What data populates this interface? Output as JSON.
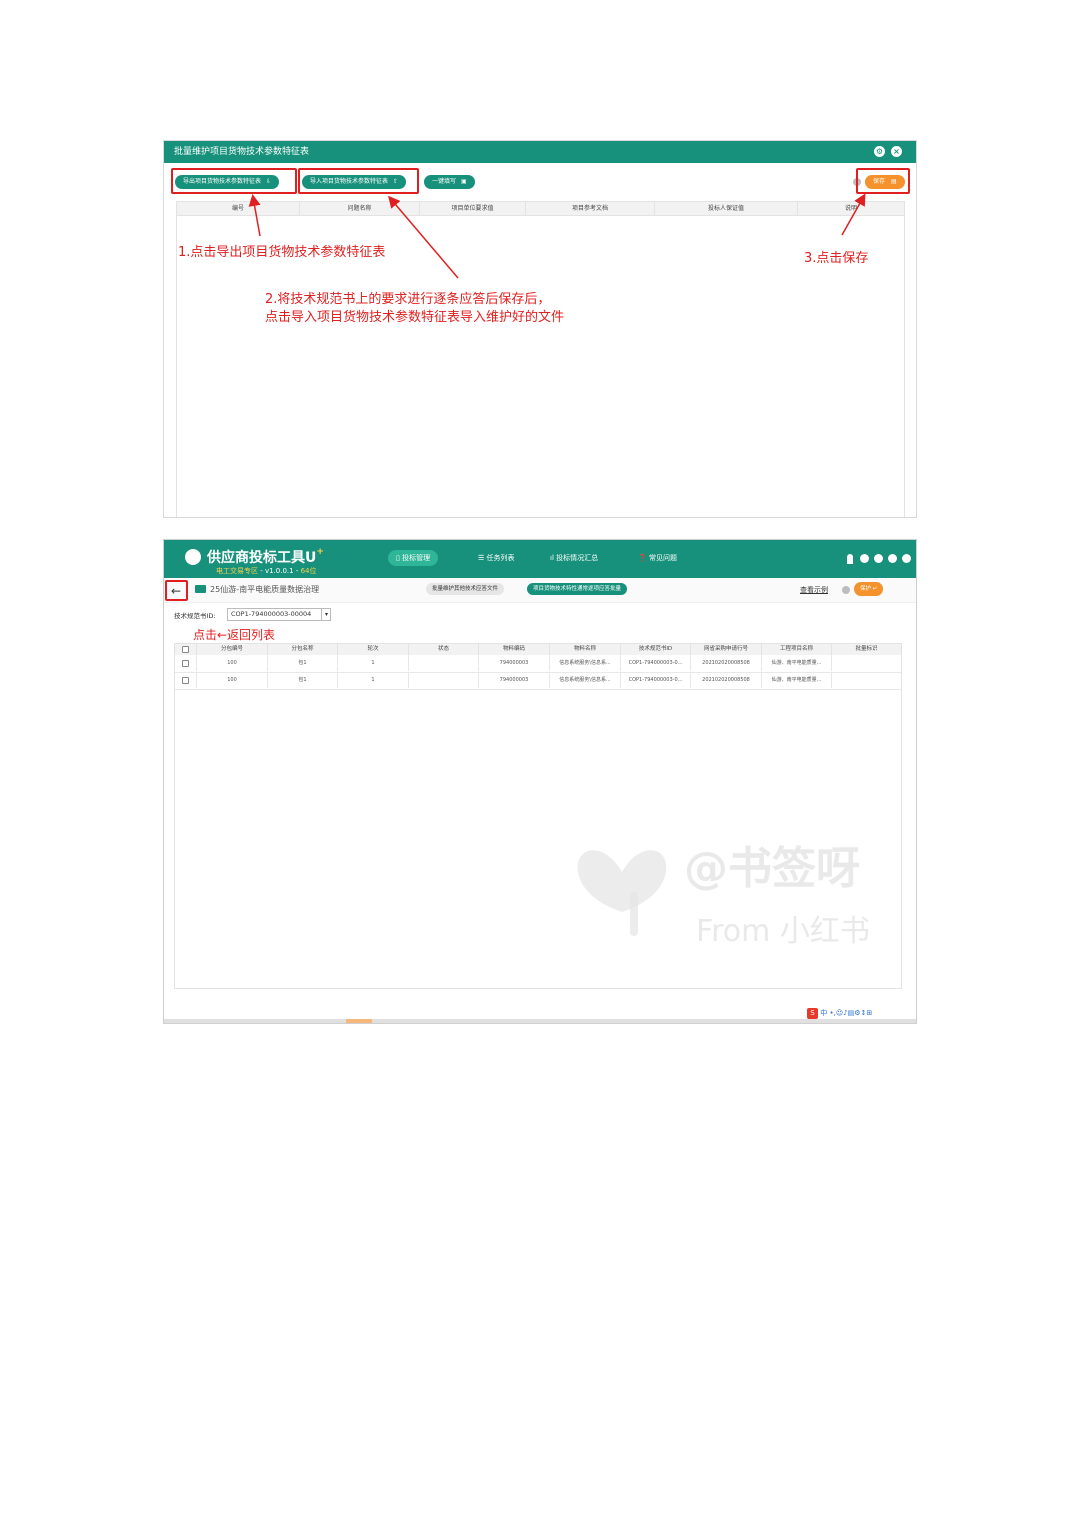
{
  "panel1": {
    "title": "批量维护项目货物技术参数特征表",
    "buttons": {
      "export": "导出项目货物技术参数特征表",
      "import": "导入项目货物技术参数特征表",
      "fill": "一键填写",
      "save": "保存"
    },
    "columns": [
      "编号",
      "问题名称",
      "项目单位要求值",
      "项目参考文档",
      "投标人保证值",
      "说明"
    ],
    "annotations": {
      "step1": "1.点击导出项目货物技术参数特征表",
      "step2_line1": "2.将技术规范书上的要求进行逐条应答后保存后，",
      "step2_line2": "点击导入项目货物技术参数特征表导入维护好的文件",
      "step3": "3.点击保存"
    }
  },
  "panel2": {
    "app_title": "供应商投标工具U",
    "app_plus": "+",
    "subtitle_zone": "电工交易专区",
    "subtitle_version": " - v1.0.0.1 - ",
    "subtitle_bits": "64位",
    "nav": [
      "投标管理",
      "任务列表",
      "投标情况汇总",
      "常见问题"
    ],
    "breadcrumb": "25仙游-南平电能质量数据治理",
    "tabs": [
      "批量维护其他技术应答文件",
      "项目货物技术特性通常逐项应答批量"
    ],
    "view_example": "查看示例",
    "save": "保护",
    "field_label": "技术规范书ID:",
    "field_value": "COP1-794000003-00004",
    "annotation_back": "点击←返回列表",
    "columns": [
      "分包编号",
      "分包名称",
      "轮次",
      "状态",
      "物料编码",
      "物料名称",
      "技术规范书ID",
      "网省采购申请行号",
      "工程项目名称",
      "批量标识"
    ],
    "rows": [
      [
        "100",
        "包1",
        "1",
        "",
        "794000003",
        "信息系统服务\\信息系...",
        "COP1-794000003-0...",
        "202102020008508",
        "仙游、南平电能质量...",
        ""
      ],
      [
        "100",
        "包1",
        "1",
        "",
        "794000003",
        "信息系统服务\\信息系...",
        "COP1-794000003-0...",
        "202102020008508",
        "仙游、南平电能质量...",
        ""
      ]
    ],
    "watermark_line1": "@书签呀",
    "watermark_line2": "From 小红书",
    "tray": "中"
  },
  "colors": {
    "primary": "#17917b",
    "accent": "#f5922b",
    "annotation": "#e02020"
  }
}
